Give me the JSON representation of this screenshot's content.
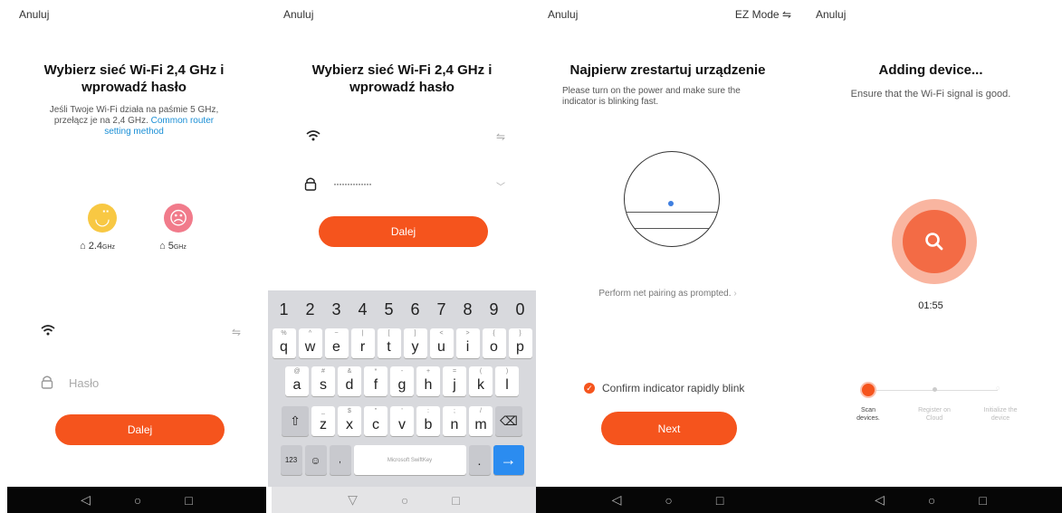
{
  "common": {
    "cancel": "Anuluj",
    "nav": {
      "back": "◁",
      "home": "○",
      "recent": "□"
    }
  },
  "panel1": {
    "title_line1": "Wybierz sieć Wi-Fi 2,4 GHz i",
    "title_line2": "wprowadź hasło",
    "sub_line1": "Jeśli Twoje Wi-Fi działa na paśmie 5 GHz,",
    "sub_line2_prefix": "przełącz je na 2,4 GHz.",
    "sub_link_line1": "Common router",
    "sub_link_line2": "setting method",
    "band_24": "2.4",
    "band_5": "5",
    "band_unit": "GHz",
    "password_placeholder": "Hasło",
    "next": "Dalej"
  },
  "panel2": {
    "title_line1": "Wybierz sieć Wi-Fi 2,4 GHz i",
    "title_line2": "wprowadź hasło",
    "password_value": "··············",
    "next": "Dalej",
    "keyboard": {
      "numbers": [
        "1",
        "2",
        "3",
        "4",
        "5",
        "6",
        "7",
        "8",
        "9",
        "0"
      ],
      "row1": [
        "q",
        "w",
        "e",
        "r",
        "t",
        "y",
        "u",
        "i",
        "o",
        "p"
      ],
      "row1_hints": [
        "%",
        "^",
        "~",
        "|",
        "[",
        "]",
        "<",
        ">",
        "{",
        "}"
      ],
      "row2": [
        "a",
        "s",
        "d",
        "f",
        "g",
        "h",
        "j",
        "k",
        "l"
      ],
      "row2_hints": [
        "@",
        "#",
        "&",
        "*",
        "-",
        "+",
        "=",
        "(",
        ")"
      ],
      "row3": [
        "z",
        "x",
        "c",
        "v",
        "b",
        "n",
        "m"
      ],
      "row3_hints": [
        "_",
        "$",
        "\"",
        "'",
        ":",
        ";",
        "/"
      ],
      "key_123": "123",
      "key_emoji": "☺",
      "key_mic": "🎙",
      "space_label": "Microsoft SwiftKey",
      "key_period": ".",
      "key_enter": "→",
      "key_shift": "⇧",
      "key_backspace": "⌫"
    }
  },
  "panel3": {
    "mode": "EZ Mode ⇋",
    "title": "Najpierw zrestartuj urządzenie",
    "sub_line1": "Please turn on the power and make sure the",
    "sub_line2": "indicator is blinking fast.",
    "pairing_link": "Perform net pairing as prompted.",
    "confirm": "Confirm indicator rapidly blink",
    "next": "Next"
  },
  "panel4": {
    "title": "Adding device...",
    "subtitle": "Ensure that the Wi-Fi signal is good.",
    "timer": "01:55",
    "steps": [
      {
        "line1": "Scan",
        "line2": "devices."
      },
      {
        "line1": "Register on",
        "line2": "Cloud"
      },
      {
        "line1": "Initialize the",
        "line2": "device"
      }
    ]
  },
  "colors": {
    "accent": "#f5541d",
    "link": "#1a8fd6",
    "enter": "#2b8cf0"
  }
}
